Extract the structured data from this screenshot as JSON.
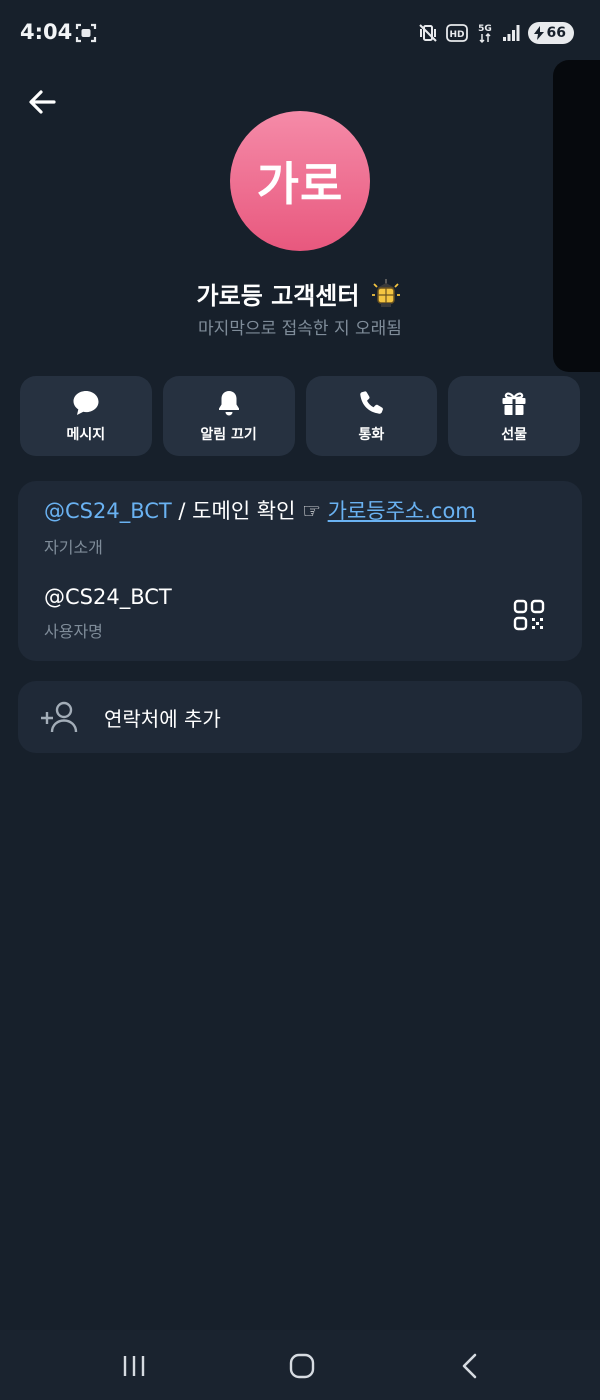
{
  "status_bar": {
    "time": "4:04",
    "icons": [
      "screen-record-icon",
      "mute-vibrate-icon",
      "hd-icon",
      "5g-icon",
      "signal-icon",
      "battery-charging-icon"
    ],
    "hd_label": "HD",
    "network_label": "5G",
    "battery_level": "66"
  },
  "header": {
    "back_icon": "arrow-left-icon"
  },
  "profile": {
    "avatar_text": "가로",
    "avatar_colors": [
      "#f58ba8",
      "#e8587e"
    ],
    "name": "가로등 고객센터",
    "status_emoji": "lantern-emoji",
    "last_seen": "마지막으로 접속한 지 오래됨"
  },
  "actions": [
    {
      "label": "메시지",
      "icon": "chat-bubble-icon"
    },
    {
      "label": "알림 끄기",
      "icon": "bell-icon"
    },
    {
      "label": "통화",
      "icon": "phone-icon"
    },
    {
      "label": "선물",
      "icon": "gift-icon"
    }
  ],
  "info": {
    "bio": {
      "mention": "@CS24_BCT",
      "middle": " / 도메인 확인 ☞ ",
      "domain": "가로등주소.com",
      "caption": "자기소개"
    },
    "username": {
      "value": "@CS24_BCT",
      "caption": "사용자명",
      "qr_icon": "qr-code-icon"
    }
  },
  "add_contact": {
    "label": "연락처에 추가",
    "icon": "add-person-icon"
  },
  "nav_bar": {
    "buttons": [
      "recent-apps-icon",
      "home-icon",
      "back-icon"
    ]
  },
  "colors": {
    "background": "#17202b",
    "card": "#1f2937",
    "button": "#263140",
    "link": "#6ab2f2",
    "muted_text": "#7f8c99"
  }
}
